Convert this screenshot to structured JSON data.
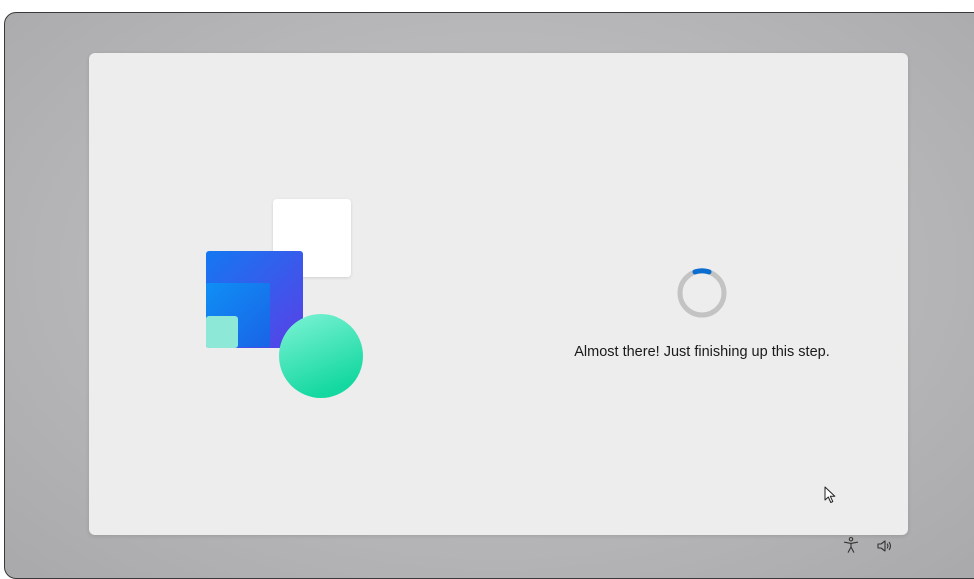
{
  "setup": {
    "status_message": "Almost there! Just finishing up this step.",
    "progress_state": "indeterminate"
  },
  "icons": {
    "spinner": "progress-ring-icon",
    "cursor": "mouse-pointer-icon",
    "accessibility": "accessibility-icon",
    "volume": "volume-icon"
  },
  "colors": {
    "accent": "#0a6ed1",
    "card_background": "#ededed",
    "screen_background": "#b7b7b9",
    "tile_blue": "#1d6ff0",
    "tile_violet": "#5b3ee8",
    "tile_mint": "#8de8d8",
    "circle_teal": "#2fdfae"
  }
}
